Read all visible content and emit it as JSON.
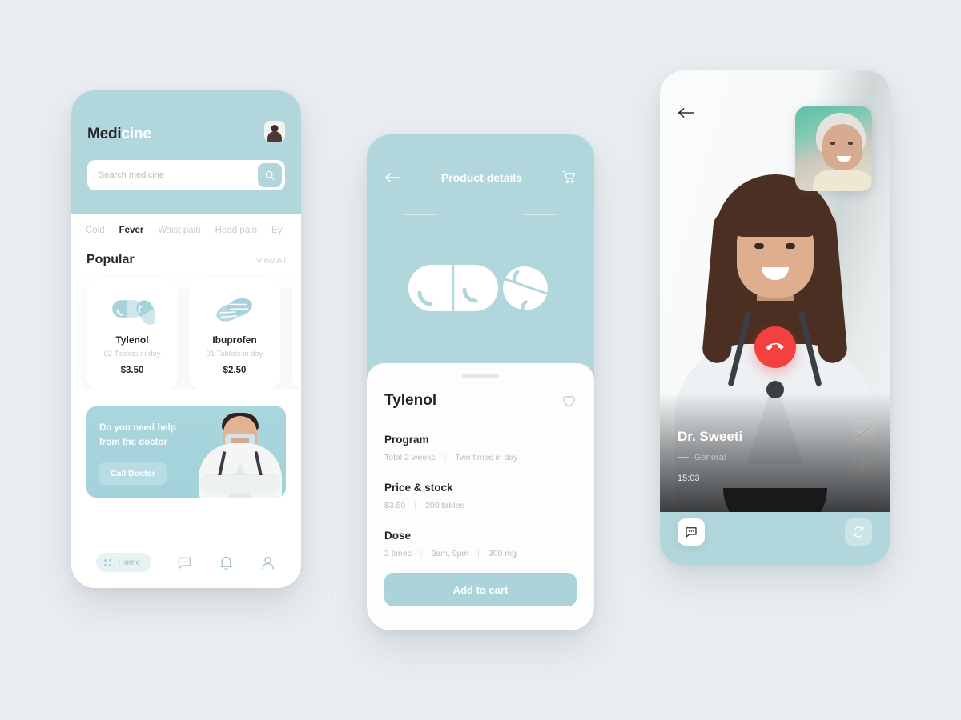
{
  "theme": {
    "page_bg": "#eaeef1",
    "teal": "#b1d7dd",
    "teal_dark": "#abd3da",
    "dark_text": "#23242a",
    "muted_text": "#c0c5c9",
    "danger": "#f54040"
  },
  "home": {
    "brand_part_dark": "Medi",
    "brand_part_light": "cine",
    "avatar_name": "user-avatar",
    "search": {
      "placeholder": "Search medicine",
      "icon": "search-icon"
    },
    "categories": [
      {
        "label": "Cold",
        "active": false
      },
      {
        "label": "Fever",
        "active": true
      },
      {
        "label": "Waist pain",
        "active": false
      },
      {
        "label": "Head pain",
        "active": false
      },
      {
        "label": "Ey",
        "active": false
      }
    ],
    "section": {
      "title": "Popular",
      "view_all": "View All"
    },
    "medicines": [
      {
        "name": "Tylenol",
        "sub": "02 Tablets in day",
        "price": "$3.50",
        "icon": "capsule-icon"
      },
      {
        "name": "Ibuprofen",
        "sub": "01 Tablets in day",
        "price": "$2.50",
        "icon": "tablets-icon"
      },
      {
        "name": "",
        "sub": "",
        "price": "",
        "icon": "capsule-icon"
      }
    ],
    "promo": {
      "line1": "Do you need help",
      "line2": "from the doctor",
      "button": "Call Doctor"
    },
    "nav": [
      {
        "label": "Home",
        "icon": "grid-icon",
        "active": true
      },
      {
        "label": "",
        "icon": "chat-icon",
        "active": false
      },
      {
        "label": "",
        "icon": "bell-icon",
        "active": false
      },
      {
        "label": "",
        "icon": "profile-icon",
        "active": false
      }
    ]
  },
  "detail": {
    "header": {
      "back_icon": "back-arrow-icon",
      "title": "Product details",
      "cart_icon": "cart-icon",
      "hero_icon": "pills-illustration"
    },
    "product_name": "Tylenol",
    "favorite_icon": "heart-icon",
    "blocks": [
      {
        "heading": "Program",
        "meta": [
          "Total 2 weeks",
          "Two times in day"
        ]
      },
      {
        "heading": "Price & stock",
        "meta": [
          "$3.50",
          "200 tables"
        ]
      },
      {
        "heading": "Dose",
        "meta": [
          "2 times",
          "9am, 9pm",
          "300 mg"
        ]
      }
    ],
    "add_to_cart": "Add to cart"
  },
  "call": {
    "back_icon": "back-arrow-icon",
    "pip_label": "self-preview",
    "doctor_name": "Dr. Sweeti",
    "specialty": "General",
    "duration": "15:03",
    "side_controls": [
      {
        "icon": "video-off-icon"
      },
      {
        "icon": "mic-off-icon"
      }
    ],
    "end_call_icon": "end-call-icon",
    "bottom_controls": [
      {
        "icon": "chat-icon"
      },
      {
        "icon": "flip-camera-icon"
      }
    ]
  }
}
